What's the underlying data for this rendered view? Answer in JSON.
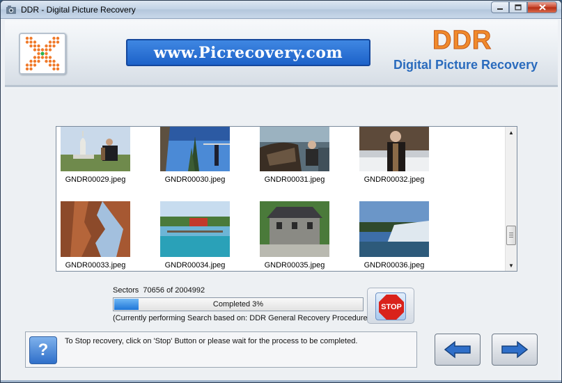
{
  "window": {
    "title": "DDR - Digital Picture Recovery",
    "icon": "app-icon",
    "controls": [
      "minimize-icon",
      "maximize-icon",
      "close-icon"
    ]
  },
  "header": {
    "url": "www.Picrecovery.com",
    "brand": "DDR",
    "subtitle": "Digital Picture Recovery",
    "logo_icon": "grid-logo-icon",
    "colors": {
      "brand": "#f08a2c",
      "subtitle": "#2a6bbd",
      "banner": "#1d62c9"
    }
  },
  "gallery": {
    "items": [
      {
        "name": "GNDR00029.jpeg",
        "thumb": "photo-thumbnail"
      },
      {
        "name": "GNDR00030.jpeg",
        "thumb": "photo-thumbnail"
      },
      {
        "name": "GNDR00031.jpeg",
        "thumb": "photo-thumbnail"
      },
      {
        "name": "GNDR00032.jpeg",
        "thumb": "photo-thumbnail"
      },
      {
        "name": "GNDR00033.jpeg",
        "thumb": "photo-thumbnail"
      },
      {
        "name": "GNDR00034.jpeg",
        "thumb": "photo-thumbnail"
      },
      {
        "name": "GNDR00035.jpeg",
        "thumb": "photo-thumbnail"
      },
      {
        "name": "GNDR00036.jpeg",
        "thumb": "photo-thumbnail"
      }
    ]
  },
  "status": {
    "sectors_label": "Sectors",
    "sectors_text": "70656 of 2004992",
    "progress_label": "Completed 3%",
    "progress_value": 0.03,
    "search_note": "(Currently performing Search based on:  DDR General Recovery Procedure)"
  },
  "stop_button": {
    "label": "STOP",
    "color": "#d9221b"
  },
  "info": {
    "text": "To Stop recovery, click on 'Stop' Button or please wait for the process to be completed.",
    "help_icon": "question-mark-icon"
  },
  "navigation": {
    "back_icon": "arrow-left-icon",
    "next_icon": "arrow-right-icon"
  }
}
